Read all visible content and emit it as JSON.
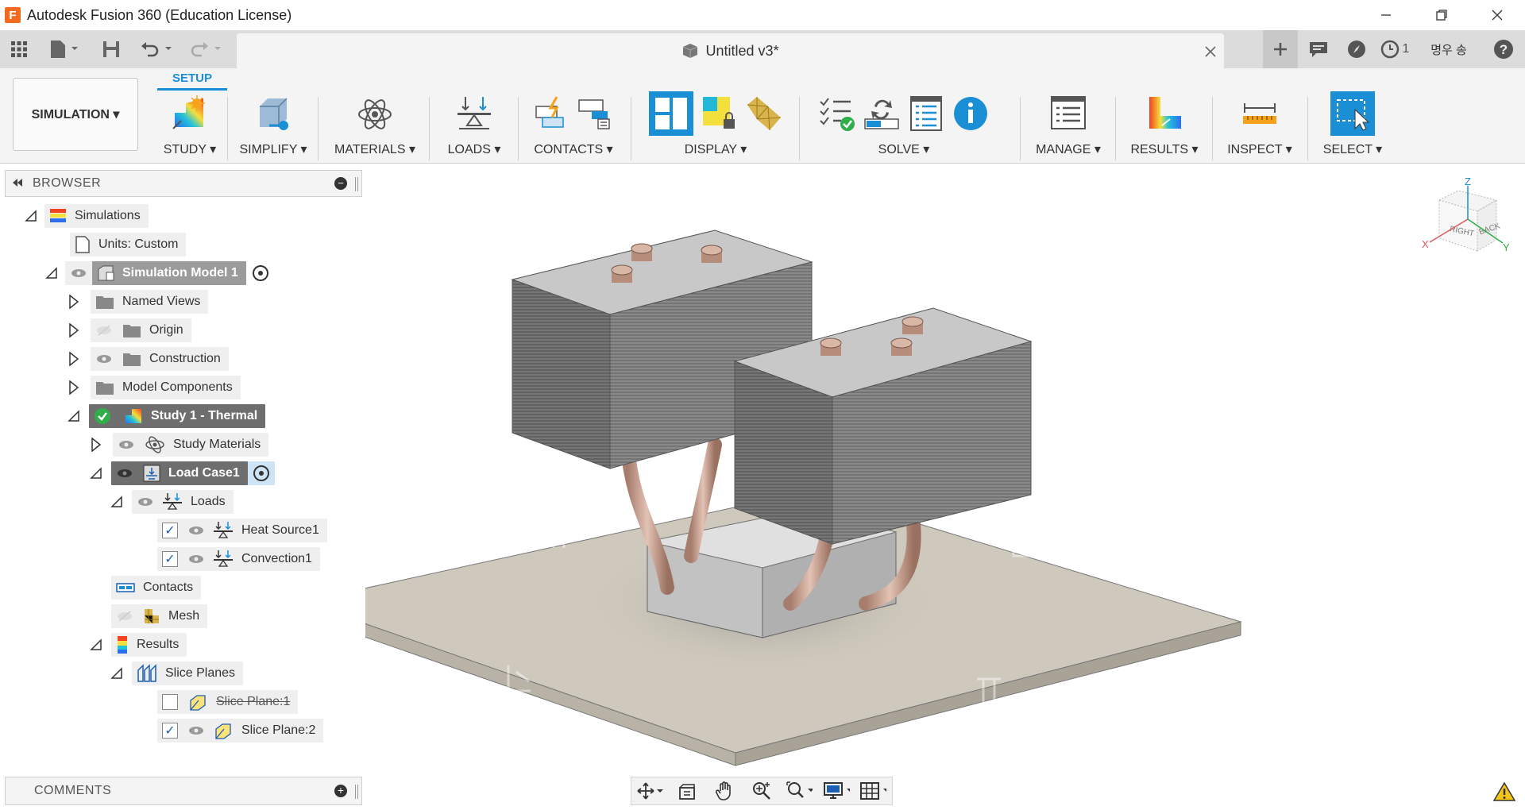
{
  "window": {
    "app_logo": "F",
    "title": "Autodesk Fusion 360 (Education License)",
    "controls": [
      "minimize-icon",
      "restore-icon",
      "close-icon"
    ]
  },
  "quick_access": {
    "document_title": "Untitled v3*",
    "user_name": "명우 송",
    "job_count": "1"
  },
  "ribbon": {
    "workspace": "SIMULATION ▾",
    "active_tab": "SETUP",
    "groups": {
      "study": "STUDY ▾",
      "simplify": "SIMPLIFY ▾",
      "materials": "MATERIALS ▾",
      "loads": "LOADS ▾",
      "contacts": "CONTACTS ▾",
      "display": "DISPLAY ▾",
      "solve": "SOLVE ▾",
      "manage": "MANAGE ▾",
      "results": "RESULTS ▾",
      "inspect": "INSPECT ▾",
      "select": "SELECT ▾"
    }
  },
  "browser": {
    "title": "BROWSER",
    "items": {
      "simulations": "Simulations",
      "units": "Units: Custom",
      "model": "Simulation Model 1",
      "named_views": "Named Views",
      "origin": "Origin",
      "construction": "Construction",
      "model_components": "Model Components",
      "study": "Study 1 - Thermal",
      "study_materials": "Study Materials",
      "load_case": "Load Case1",
      "loads": "Loads",
      "heat_source": "Heat Source1",
      "convection": "Convection1",
      "contacts": "Contacts",
      "mesh": "Mesh",
      "results": "Results",
      "slice_planes": "Slice Planes",
      "slice_plane_1": "Slice Plane:1",
      "slice_plane_2": "Slice Plane:2"
    }
  },
  "viewcube": {
    "front_label": "RIGHT",
    "side_label": "BACK",
    "axis_z": "Z",
    "axis_x": "X",
    "axis_y": "Y"
  },
  "comments": {
    "title": "COMMENTS"
  },
  "colors": {
    "accent": "#1a8fd6",
    "heat_sink": "#8c8c8c",
    "base_plate": "#cfc9bd",
    "heat_pipe": "#c9a08e"
  }
}
